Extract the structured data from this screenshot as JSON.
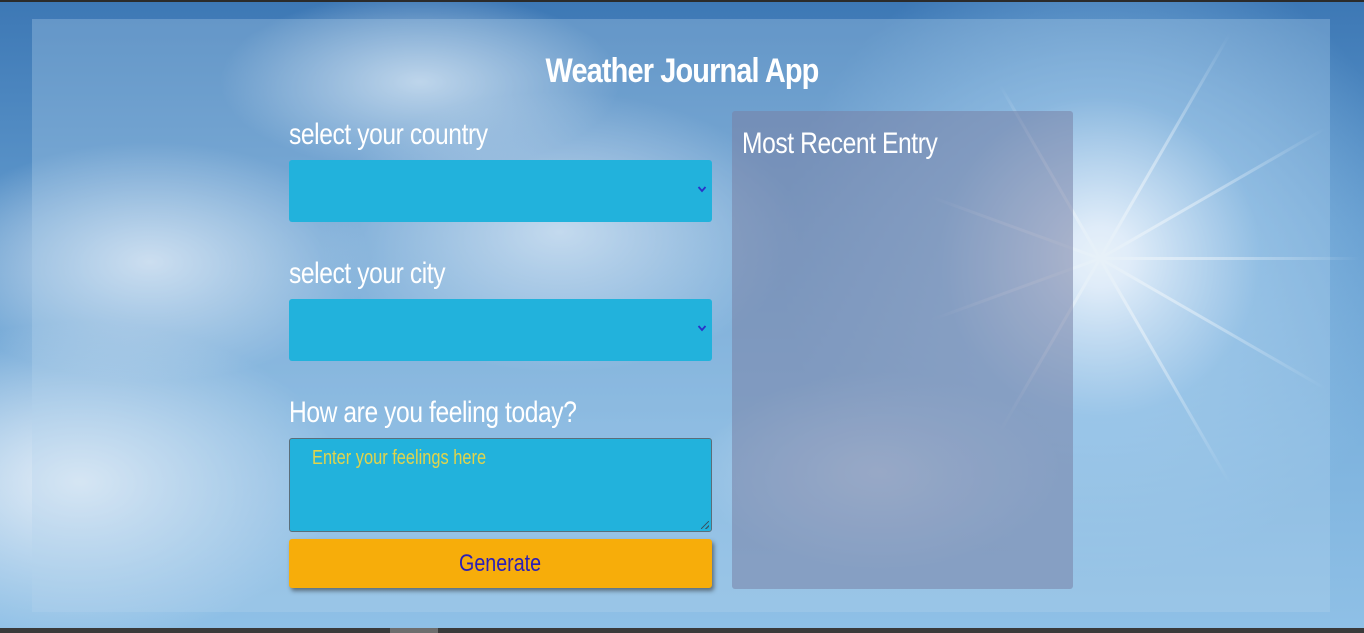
{
  "app": {
    "title": "Weather Journal App"
  },
  "form": {
    "country_label": "select your country",
    "country_value": "",
    "city_label": "select your city",
    "city_value": "",
    "feelings_label": "How are you feeling today?",
    "feelings_placeholder": "Enter your feelings here",
    "feelings_value": "",
    "generate_label": "Generate"
  },
  "entry": {
    "title": "Most Recent Entry"
  },
  "icons": {
    "select_arrow": "chevron-down-icon",
    "resize": "resize-grip-icon"
  },
  "colors": {
    "input_bg": "#22b2dc",
    "button_bg": "#f7ad0a",
    "button_text": "#2a1fb8",
    "placeholder": "#e2d44a",
    "text": "#ffffff"
  }
}
